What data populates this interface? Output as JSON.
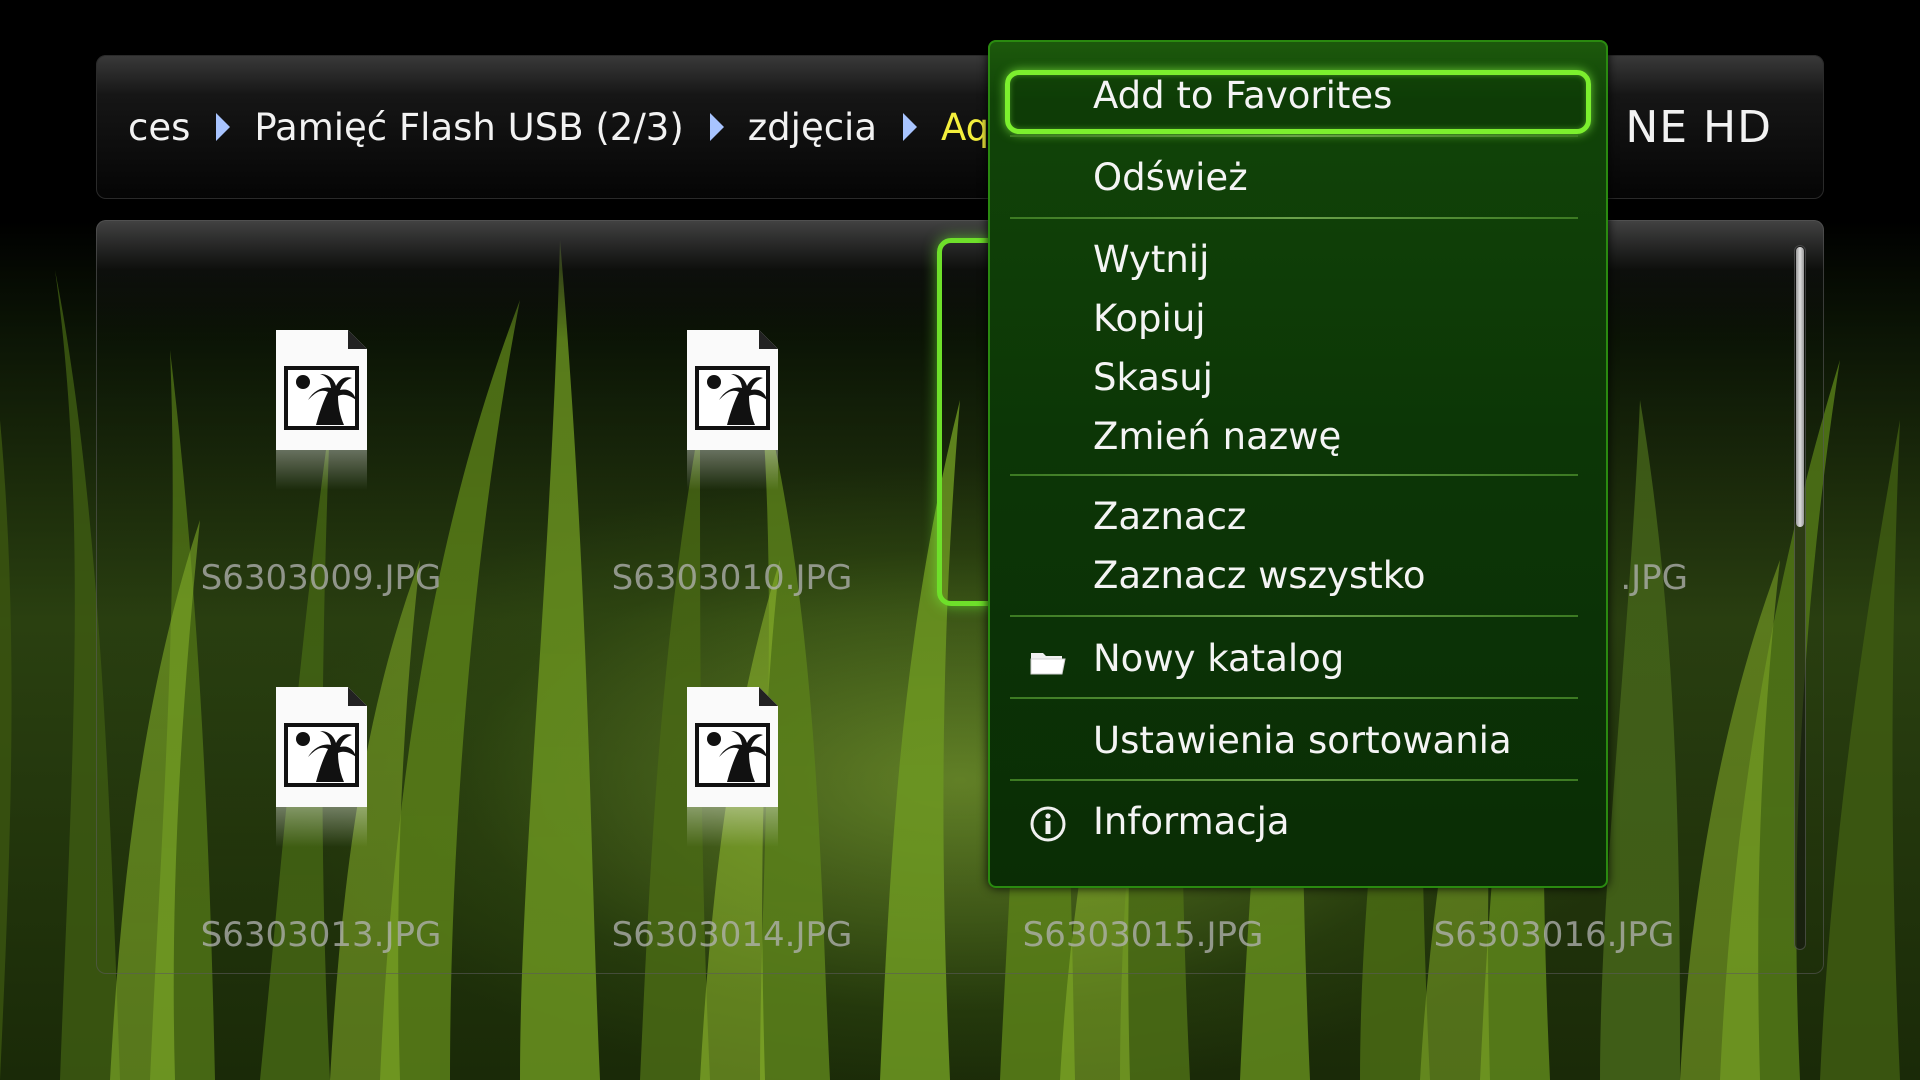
{
  "breadcrumb": {
    "items": [
      "ces",
      "Pamięć Flash USB (2/3)",
      "zdjęcia",
      "Aqua"
    ],
    "brand": "NE HD"
  },
  "files": [
    {
      "name": "S6303009.JPG"
    },
    {
      "name": "S6303010.JPG"
    },
    {
      "name": ""
    },
    {
      "name": ".JPG"
    },
    {
      "name": "S6303013.JPG"
    },
    {
      "name": "S6303014.JPG"
    },
    {
      "name": "S6303015.JPG"
    },
    {
      "name": "S6303016.JPG"
    }
  ],
  "context_menu": {
    "items": [
      {
        "label": "Add to Favorites",
        "icon": "",
        "focused": true
      },
      {
        "label": "Odśwież",
        "icon": ""
      },
      {
        "label": "Wytnij",
        "icon": ""
      },
      {
        "label": "Kopiuj",
        "icon": ""
      },
      {
        "label": "Skasuj",
        "icon": ""
      },
      {
        "label": "Zmień nazwę",
        "icon": ""
      },
      {
        "label": "Zaznacz",
        "icon": ""
      },
      {
        "label": "Zaznacz wszystko",
        "icon": ""
      },
      {
        "label": "Nowy katalog",
        "icon": "folder-icon"
      },
      {
        "label": "Ustawienia sortowania",
        "icon": ""
      },
      {
        "label": "Informacja",
        "icon": "info-icon"
      }
    ]
  },
  "scrollbar": {
    "position_fraction": 0.0,
    "visible_fraction": 0.4
  },
  "colors": {
    "accent_green": "#7cf02e",
    "menu_background": "#0c3606",
    "breadcrumb_active": "#f4ef3c",
    "breadcrumb_separator": "#a8c4ff"
  }
}
